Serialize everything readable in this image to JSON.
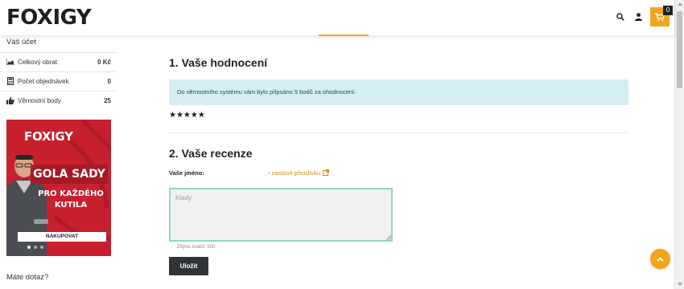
{
  "header": {
    "logo": "FOXIGY",
    "cart_count": "0"
  },
  "sidebar": {
    "account_title": "Váš účet",
    "stats": [
      {
        "icon": "area-chart-icon",
        "label": "Celkový obrat",
        "value": "0 Kč"
      },
      {
        "icon": "calculator-icon",
        "label": "Počet objednávek",
        "value": "0"
      },
      {
        "icon": "thumbs-up-icon",
        "label": "Věrnostní body",
        "value": "25"
      }
    ],
    "banner": {
      "logo": "FOXIGY",
      "title": "GOLA SADY",
      "subtitle_line1": "PRO KAŽDÉHO",
      "subtitle_line2": "KUTILA",
      "cta": "NAKUPOVAT",
      "slides": 3,
      "active_slide": 1
    },
    "question": "Máte dotaz?"
  },
  "main": {
    "rating_title": "1. Vaše hodnocení",
    "rating_info": "Do věrnostního systému vám bylo připsáno 5 bodů za ohodnocení.",
    "stars": "★★★★★",
    "rating_stars": 5,
    "review_title": "2. Vaše recenze",
    "name_label": "Vaše jméno:",
    "nickname_prefix": "- ",
    "nickname_link": "nastavit přezdívku",
    "review_placeholder": "Klady",
    "char_count": "Zbývá znaků: 500",
    "save_label": "Uložit"
  },
  "colors": {
    "accent": "#f2a51c",
    "info_bg": "#d4eef1",
    "textarea_border": "#8fd7ca",
    "button_dark": "#2e3338",
    "banner_red": "#c8202f"
  }
}
